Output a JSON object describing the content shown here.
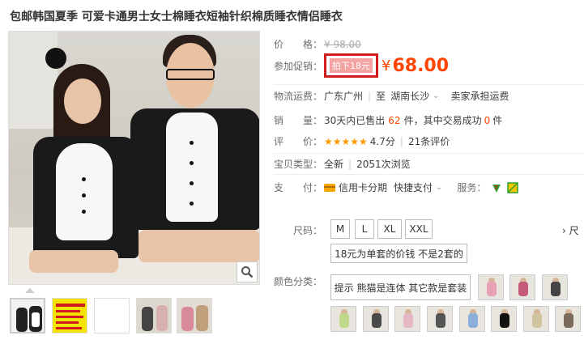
{
  "title": "包邮韩国夏季 可爱卡通男士女士棉睡衣短袖针织棉质睡衣情侣睡衣",
  "price": {
    "label": "价　　格：",
    "original": "¥ 98.00"
  },
  "promo": {
    "label": "参加促销：",
    "tag": "拍下18元",
    "currency": "¥",
    "value": "68.00"
  },
  "shipping": {
    "label": "物流运费：",
    "from": "广东广州",
    "to_prefix": "至",
    "to": "湖南长沙",
    "fee": "卖家承担运费"
  },
  "sales": {
    "label": "销　　量：",
    "prefix": "30天内已售出",
    "count": "62",
    "mid": "件，其中交易成功",
    "success": "0",
    "suffix": "件"
  },
  "rating": {
    "label": "评　　价：",
    "stars": "★★★★★",
    "score": "4.7分",
    "reviews": "21条评价"
  },
  "type": {
    "label": "宝贝类型：",
    "condition": "全新",
    "views": "2051次浏览"
  },
  "payment": {
    "label": "支　　付：",
    "method1": "信用卡分期",
    "method2": "快捷支付",
    "service_label": "服务："
  },
  "size": {
    "label": "尺码：",
    "options": [
      "M",
      "L",
      "XL",
      "XXL"
    ],
    "note": "18元为单套的价钱 不是2套的",
    "more": "尺"
  },
  "color": {
    "label": "颜色分类：",
    "text_option": "提示 熊猫是连体 其它款是套装"
  },
  "colors": {
    "accent": "#ff4400",
    "promo_box": "#d01c1c",
    "star": "#ff9900"
  }
}
